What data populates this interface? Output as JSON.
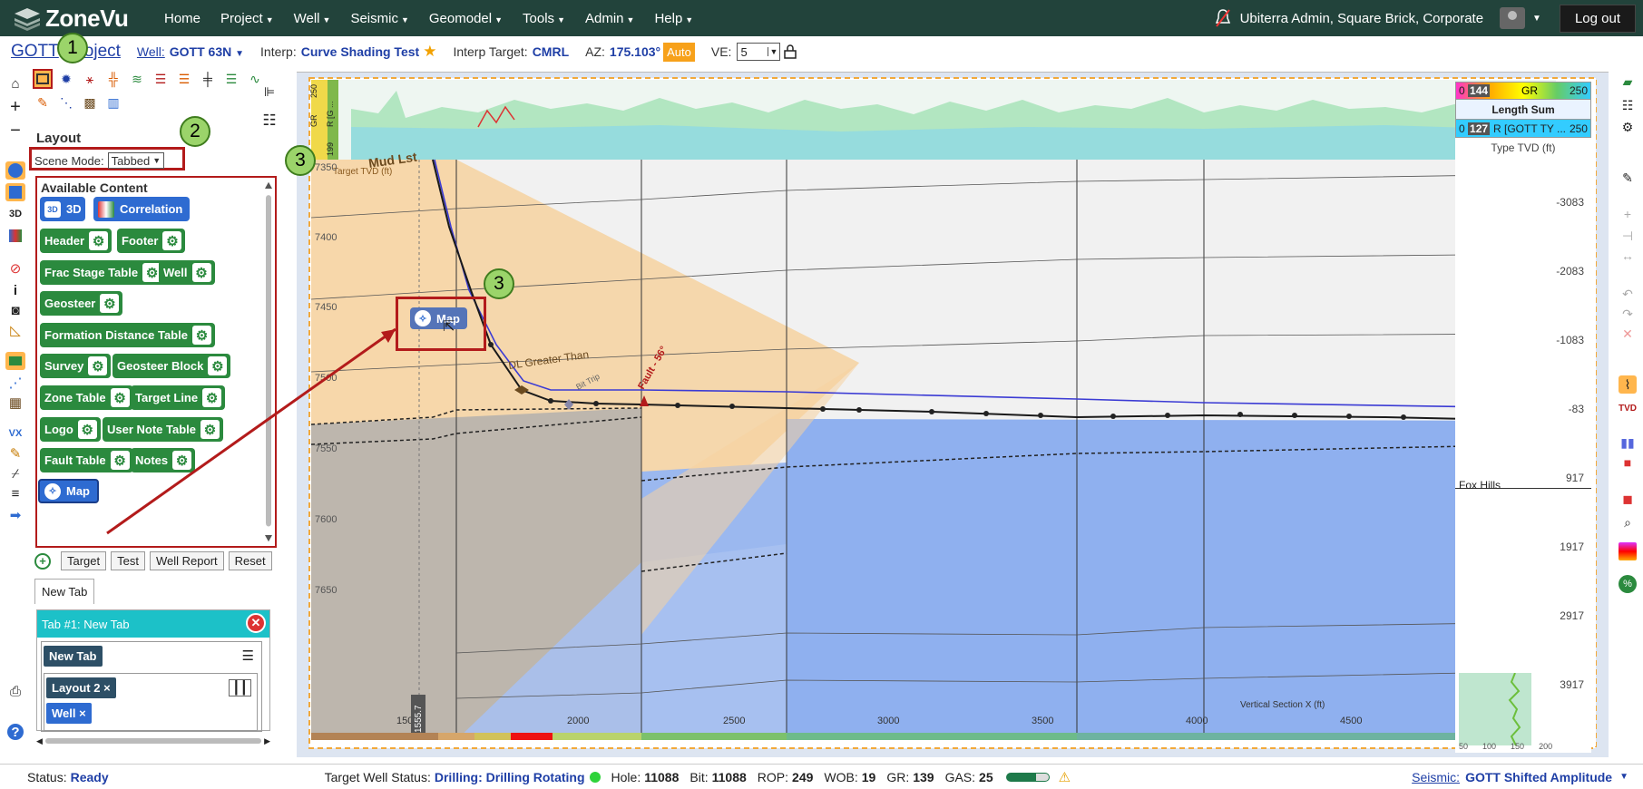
{
  "app": {
    "logo_text": "ZoneVu"
  },
  "nav": {
    "items": [
      {
        "label": "Home"
      },
      {
        "label": "Project",
        "caret": true
      },
      {
        "label": "Well",
        "caret": true
      },
      {
        "label": "Seismic",
        "caret": true
      },
      {
        "label": "Geomodel",
        "caret": true
      },
      {
        "label": "Tools",
        "caret": true
      },
      {
        "label": "Admin",
        "caret": true
      },
      {
        "label": "Help",
        "caret": true
      }
    ],
    "user": "Ubiterra Admin, Square Brick, Corporate",
    "logout": "Log out"
  },
  "subbar": {
    "project_part1": "GOTT",
    "project_part2": "oject",
    "well_label": "Well:",
    "well_value": "GOTT 63N",
    "interp_label": "Interp:",
    "interp_value": "Curve Shading Test",
    "interp_target_label": "Interp Target:",
    "interp_target_value": "CMRL",
    "az_label": "AZ:",
    "az_value": "175.103°",
    "auto": "Auto",
    "ve_label": "VE:",
    "ve_value": "5"
  },
  "panel": {
    "title": "Layout",
    "scene_mode_label": "Scene Mode:",
    "scene_mode_value": "Tabbed",
    "available_title": "Available Content",
    "chips": {
      "three_d": "3D",
      "correlation": "Correlation",
      "header": "Header",
      "footer": "Footer",
      "frac": "Frac Stage Table",
      "well": "Well",
      "geosteer": "Geosteer",
      "formation": "Formation Distance Table",
      "survey": "Survey",
      "geosteer_block": "Geosteer Block",
      "zone_table": "Zone Table",
      "target_line": "Target Line",
      "logo": "Logo",
      "user_note": "User Note Table",
      "fault_table": "Fault Table",
      "notes": "Notes",
      "map": "Map"
    },
    "buttons": {
      "target": "Target",
      "test": "Test",
      "well_report": "Well Report",
      "reset": "Reset"
    },
    "new_tab": "New Tab",
    "tab_title": "Tab #1: New Tab",
    "tab_inner": "New Tab",
    "layout_chip": "Layout 2 ×",
    "well_chip": "Well ×"
  },
  "callouts": {
    "one": "1",
    "two": "2",
    "three_a": "3",
    "three_b": "3"
  },
  "drag": {
    "label": "Map"
  },
  "chart": {
    "depth_ticks": [
      "7350",
      "7400",
      "7450",
      "7500",
      "7550",
      "7600",
      "7650"
    ],
    "x_ticks": [
      "150",
      "2000",
      "2500",
      "3000",
      "3500",
      "4000",
      "4500"
    ],
    "cursor_value": "1555.7",
    "x_axis_label": "Vertical Section X (ft)",
    "target_label": "Target TVD (ft)",
    "formation_top": "Mud Lst",
    "dl_label": "DL Greater Than",
    "bit_trip": "Bit Trip",
    "fault_label": "Fault - 56°",
    "header_left_labels": [
      "250",
      "GR",
      "0",
      "R [G ...",
      "199"
    ],
    "header_right_top": "200",
    "legend": {
      "gr_min": "0",
      "gr_val": "144",
      "gr_label": "GR",
      "gr_max": "250",
      "length_sum": "Length Sum",
      "r_min": "0",
      "r_val": "127",
      "r_label": "R [GOTT TY ...",
      "r_max": "250",
      "type_tvd": "Type TVD (ft)"
    },
    "type_ticks": [
      "-3083",
      "-2083",
      "-1083",
      "-83",
      "917",
      "1917",
      "2917",
      "3917"
    ],
    "fox_hills": "Fox Hills",
    "log_ticks": [
      "50",
      "100",
      "150",
      "200"
    ]
  },
  "status": {
    "status_label": "Status:",
    "status_value": "Ready",
    "target_label": "Target Well Status:",
    "target_value": "Drilling: Drilling Rotating",
    "hole_label": "Hole:",
    "hole_value": "11088",
    "bit_label": "Bit:",
    "bit_value": "11088",
    "rop_label": "ROP:",
    "rop_value": "249",
    "wob_label": "WOB:",
    "wob_value": "19",
    "gr_label": "GR:",
    "gr_value": "139",
    "gas_label": "GAS:",
    "gas_value": "25",
    "seismic_label": "Seismic:",
    "seismic_value": "GOTT Shifted Amplitude"
  },
  "colors": {
    "nav_bg": "#22433b",
    "accent_blue": "#1f3fa6",
    "chip_green": "#2b8a3e",
    "chip_blue": "#2e6bd1",
    "highlight_red": "#b31b1b"
  }
}
